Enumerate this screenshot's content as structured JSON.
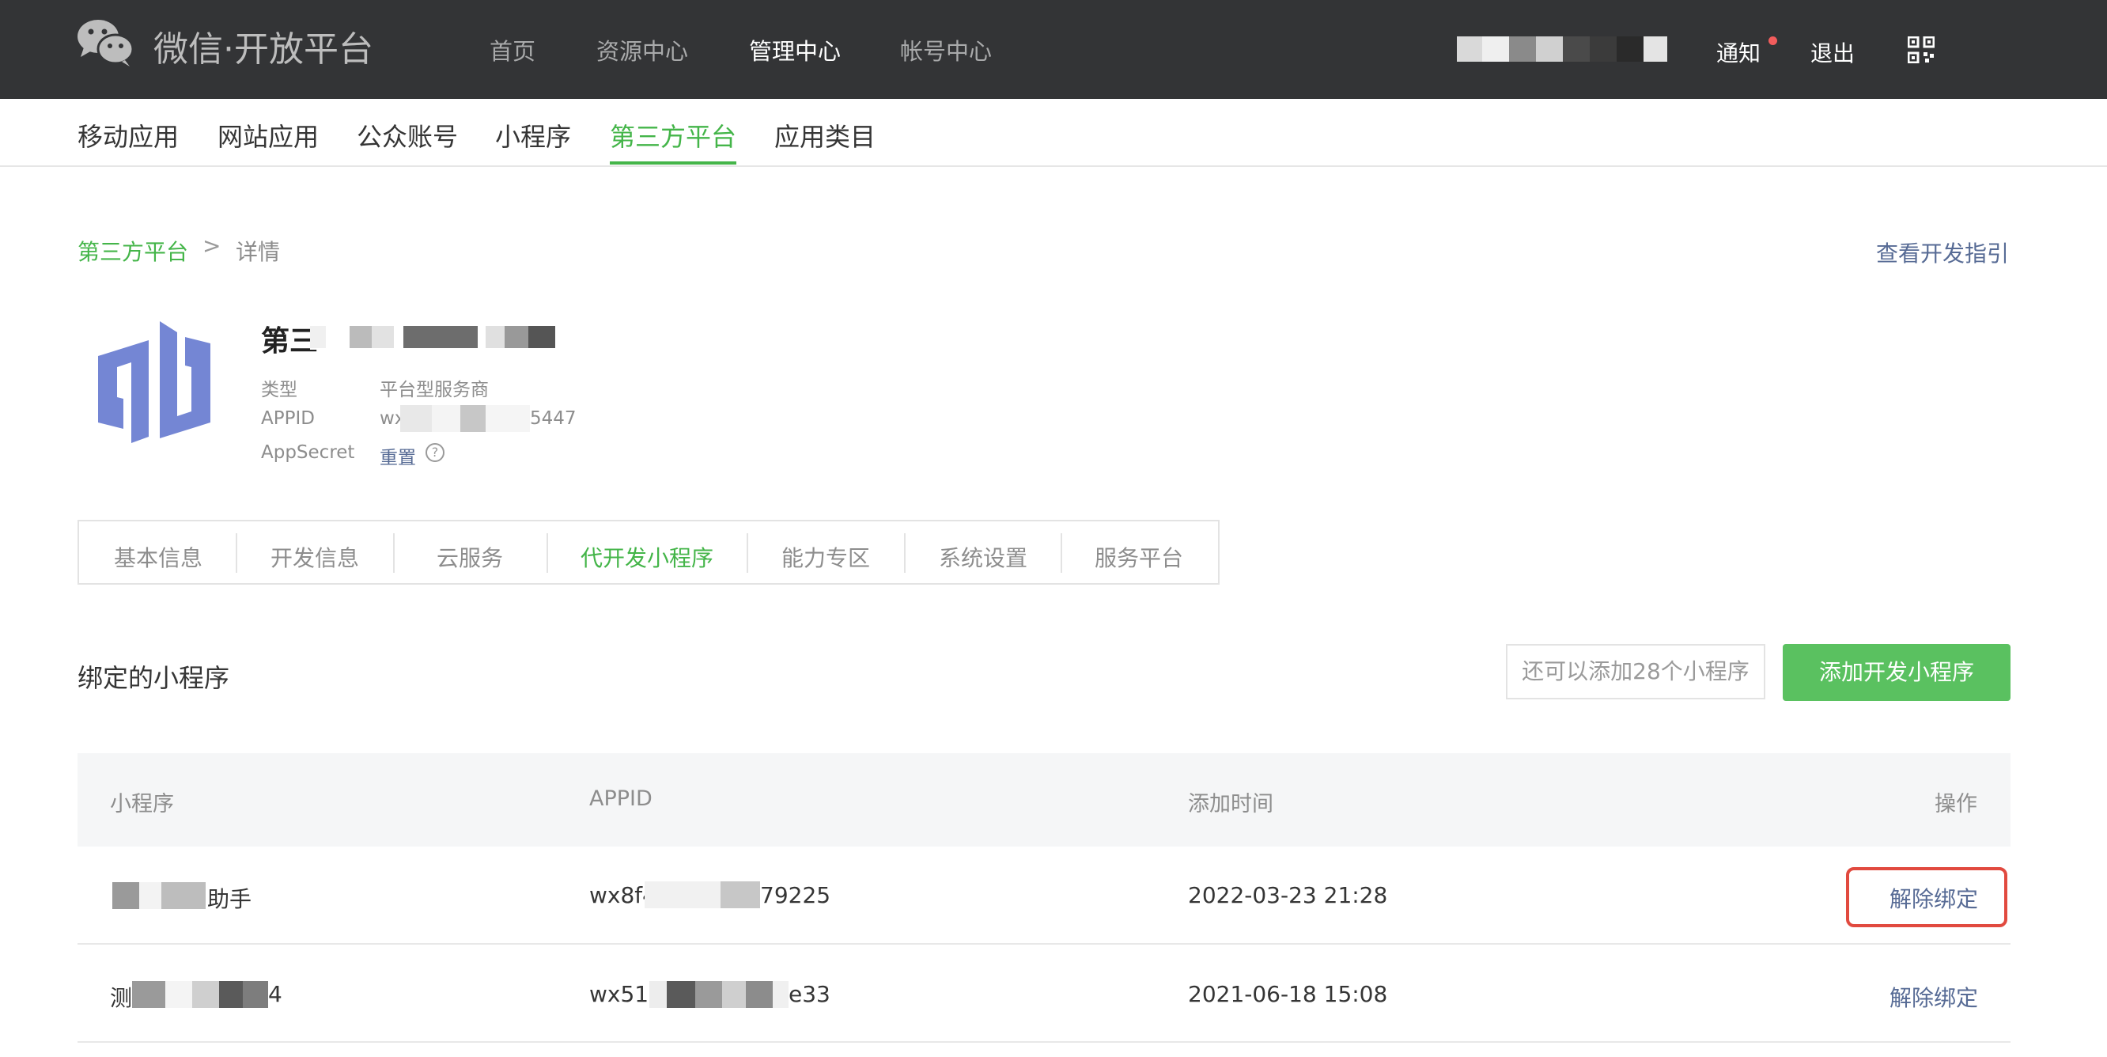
{
  "header": {
    "brand": "微信·开放平台",
    "nav": [
      "首页",
      "资源中心",
      "管理中心",
      "帐号中心"
    ],
    "active_nav": "管理中心",
    "notify": "通知",
    "logout": "退出"
  },
  "subnav": {
    "items": [
      "移动应用",
      "网站应用",
      "公众账号",
      "小程序",
      "第三方平台",
      "应用类目"
    ],
    "active": "第三方平台"
  },
  "breadcrumb": {
    "parent": "第三方平台",
    "separator": ">",
    "current": "详情"
  },
  "dev_guide": "查看开发指引",
  "app": {
    "name": "第三",
    "type_label": "类型",
    "type_value": "平台型服务商",
    "appid_label": "APPID",
    "appid_prefix": "wx",
    "appid_suffix": "5447",
    "secret_label": "AppSecret",
    "secret_action": "重置",
    "help": "?"
  },
  "tabs": {
    "items": [
      "基本信息",
      "开发信息",
      "云服务",
      "代开发小程序",
      "能力专区",
      "系统设置",
      "服务平台"
    ],
    "active": "代开发小程序"
  },
  "section": {
    "title": "绑定的小程序",
    "quota": "还可以添加28个小程序",
    "add_button": "添加开发小程序"
  },
  "table": {
    "headers": [
      "小程序",
      "APPID",
      "添加时间",
      "操作"
    ],
    "rows": [
      {
        "name_suffix": "助手",
        "appid_prefix": "wx8f4",
        "appid_suffix": "79225",
        "time": "2022-03-23 21:28",
        "action": "解除绑定"
      },
      {
        "name_prefix": "测",
        "name_suffix": "4",
        "appid_prefix": "wx516",
        "appid_suffix": "e33",
        "time": "2021-06-18 15:08",
        "action": "解除绑定"
      }
    ]
  },
  "colors": {
    "brand_green": "#44b549",
    "button_green": "#5ac160",
    "link_blue": "#576b95",
    "topbar": "#333436",
    "highlight_red": "#e14a3f"
  }
}
